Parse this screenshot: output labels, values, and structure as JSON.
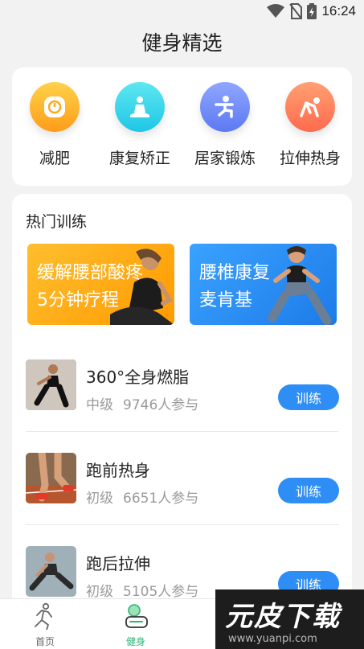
{
  "status_bar": {
    "time": "16:24",
    "icons": [
      "wifi-icon",
      "no-sim-icon",
      "battery-charging-icon"
    ]
  },
  "page": {
    "title": "健身精选"
  },
  "categories": [
    {
      "label": "减肥",
      "icon": "scale-icon",
      "color_from": "#ffd24a",
      "color_to": "#ff9c1a"
    },
    {
      "label": "康复矫正",
      "icon": "meditation-icon",
      "color_from": "#5ee7f0",
      "color_to": "#1fc6e6"
    },
    {
      "label": "居家锻炼",
      "icon": "squat-icon",
      "color_from": "#8fa6ff",
      "color_to": "#5c79f2"
    },
    {
      "label": "拉伸热身",
      "icon": "stretch-icon",
      "color_from": "#ffa074",
      "color_to": "#ff6a4d"
    }
  ],
  "hot": {
    "title": "热门训练",
    "banners": [
      {
        "line1": "缓解腰部酸疼",
        "line2": "5分钟疗程",
        "color_from": "#ffbe2e",
        "color_to": "#ff9a00"
      },
      {
        "line1": "腰椎康复",
        "line2": "麦肯基",
        "color_from": "#3aa2ff",
        "color_to": "#1d7be8"
      }
    ],
    "workouts": [
      {
        "name": "360°全身燃脂",
        "level": "中级",
        "participants": "9746人参与",
        "button": "训练"
      },
      {
        "name": "跑前热身",
        "level": "初级",
        "participants": "6651人参与",
        "button": "训练"
      },
      {
        "name": "跑后拉伸",
        "level": "初级",
        "participants": "5105人参与",
        "button": "训练"
      }
    ]
  },
  "tab_bar": {
    "tabs": [
      {
        "label": "首页",
        "icon": "running-person-icon",
        "active": false
      },
      {
        "label": "健身",
        "icon": "fitness-icon",
        "active": true
      }
    ]
  },
  "watermark": {
    "title": "元皮下载",
    "url": "www.yuanpi.com"
  },
  "colors": {
    "accent": "#2e8ef5",
    "active_tab": "#2bb673"
  }
}
